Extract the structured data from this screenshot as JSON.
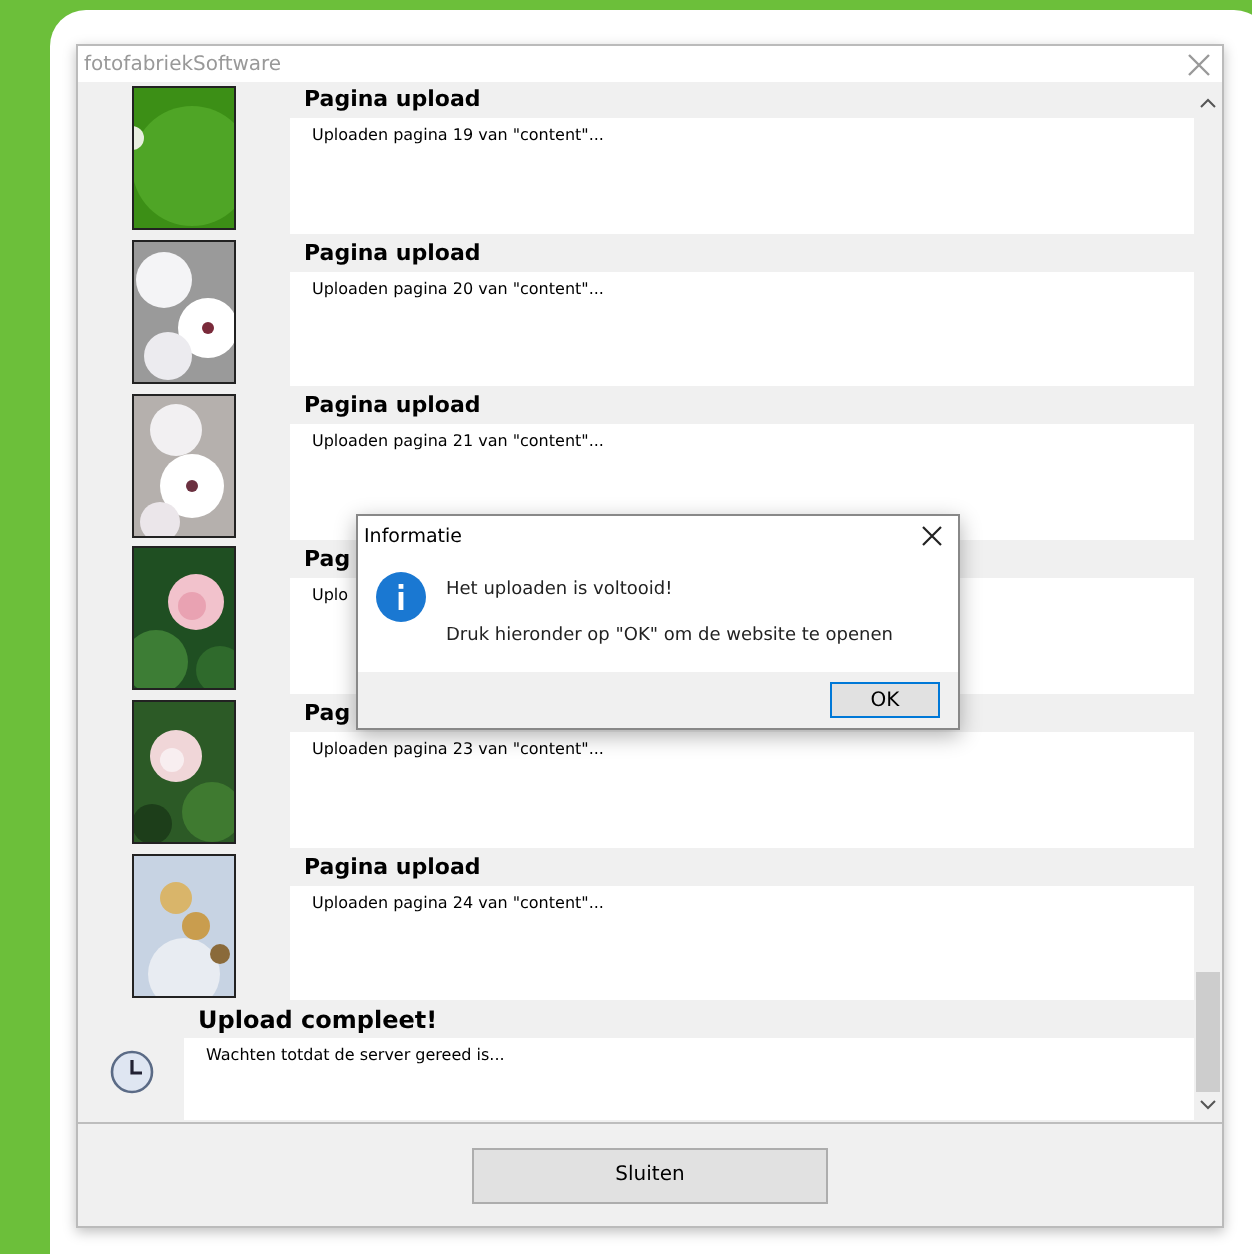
{
  "window": {
    "title": "fotofabriekSoftware"
  },
  "entries": [
    {
      "kind": "page",
      "heading": "Pagina upload",
      "text": "Uploaden pagina 19 van \"content\"..."
    },
    {
      "kind": "page",
      "heading": "Pagina upload",
      "text": "Uploaden pagina 20 van \"content\"..."
    },
    {
      "kind": "page",
      "heading": "Pagina upload",
      "text": "Uploaden pagina 21 van \"content\"..."
    },
    {
      "kind": "page",
      "heading": "Pag",
      "text": "Uplo"
    },
    {
      "kind": "page",
      "heading": "Pag",
      "text": "Uploaden pagina 23 van \"content\"..."
    },
    {
      "kind": "page",
      "heading": "Pagina upload",
      "text": "Uploaden pagina 24 van \"content\"..."
    },
    {
      "kind": "status",
      "heading": "Upload compleet!",
      "text": "Wachten totdat de server gereed is..."
    }
  ],
  "dialog": {
    "title": "Informatie",
    "message": "Het uploaden is voltooid!",
    "detail": "Druk hieronder op \"OK\" om de website te openen",
    "button": "OK"
  },
  "footer": {
    "button": "Sluiten"
  }
}
